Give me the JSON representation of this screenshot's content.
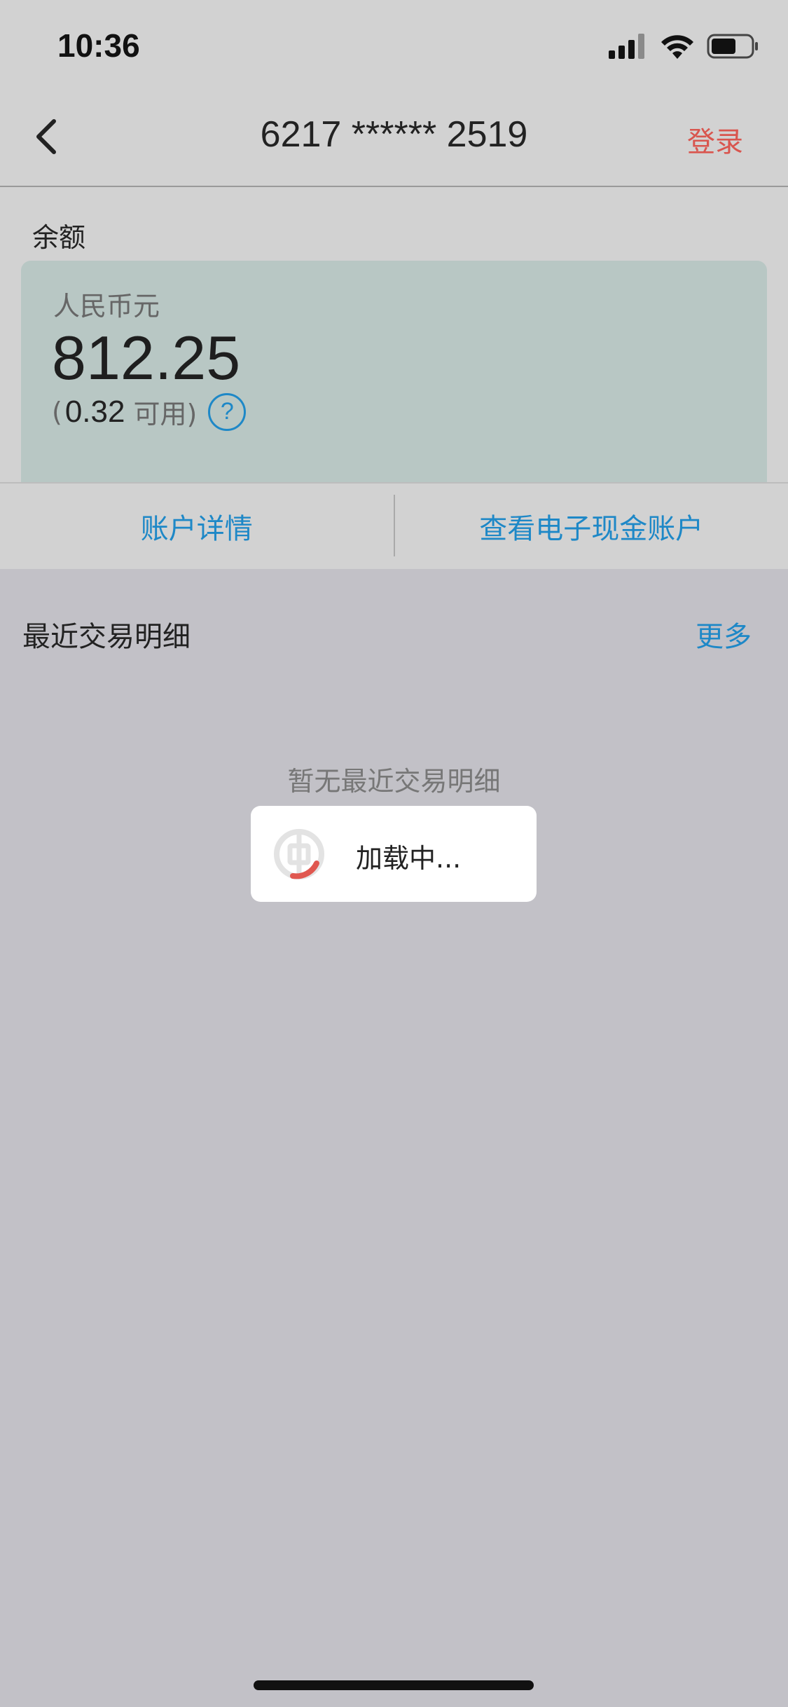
{
  "status_bar": {
    "time": "10:36",
    "icons": [
      "signal-icon",
      "wifi-icon",
      "battery-icon"
    ]
  },
  "nav": {
    "title": "6217 ****** 2519",
    "login_label": "登录",
    "back_icon": "chevron-left-icon"
  },
  "balance": {
    "label": "余额",
    "currency": "人民币元",
    "amount": "812.25",
    "available_open": "(",
    "available_value": "0.32",
    "available_label": "可用)",
    "help_symbol": "?"
  },
  "actions": {
    "account_details": "账户详情",
    "view_ecash": "查看电子现金账户"
  },
  "recent": {
    "title": "最近交易明细",
    "more_label": "更多",
    "empty_text": "暂无最近交易明细"
  },
  "loading": {
    "text": "加载中..."
  },
  "colors": {
    "accent_blue": "#1e88c7",
    "login_red": "#d9554e",
    "card_bg": "#b8c7c4",
    "spinner_red": "#e0574f"
  }
}
